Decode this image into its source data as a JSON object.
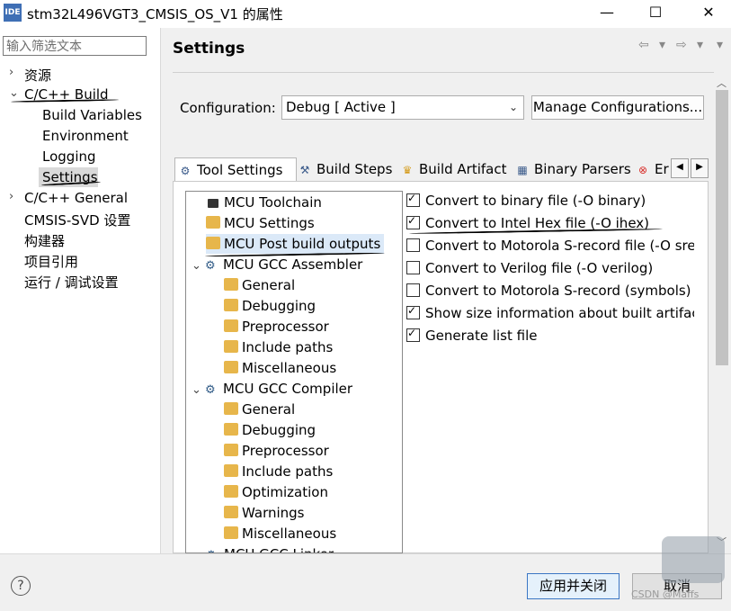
{
  "window": {
    "icon_text": "IDE",
    "title": "stm32L496VGT3_CMSIS_OS_V1 的属性",
    "minimize": "—",
    "maximize": "☐",
    "close": "✕"
  },
  "left": {
    "filter_placeholder": "输入筛选文本",
    "tree": [
      {
        "label": "资源",
        "expander": "›"
      },
      {
        "label": "C/C++ Build",
        "expander": "⌄"
      },
      {
        "label": "Build Variables"
      },
      {
        "label": "Environment"
      },
      {
        "label": "Logging"
      },
      {
        "label": "Settings"
      },
      {
        "label": "C/C++ General",
        "expander": "›"
      },
      {
        "label": "CMSIS-SVD 设置"
      },
      {
        "label": "构建器"
      },
      {
        "label": "项目引用"
      },
      {
        "label": "运行 / 调试设置"
      }
    ]
  },
  "main": {
    "title": "Settings",
    "nav": {
      "back": "⇦",
      "back_menu": "▾",
      "forward": "⇨",
      "forward_menu": "▾",
      "menu": "▾"
    },
    "configuration_label": "Configuration:",
    "configuration_value": "Debug  [ Active ]",
    "manage_label": "Manage Configurations...",
    "tabs": [
      {
        "label": "Tool Settings",
        "icon": "gear-icon"
      },
      {
        "label": "Build Steps",
        "icon": "hammer-icon"
      },
      {
        "label": "Build Artifact",
        "icon": "trophy-icon"
      },
      {
        "label": "Binary Parsers",
        "icon": "binary-icon"
      },
      {
        "label": "Er",
        "icon": "error-icon"
      }
    ],
    "tab_scroll_left": "◀",
    "tab_scroll_right": "▶",
    "tool_tree": [
      {
        "label": "MCU Toolchain"
      },
      {
        "label": "MCU Settings"
      },
      {
        "label": "MCU Post build outputs"
      },
      {
        "label": "MCU GCC Assembler"
      },
      {
        "label": "General"
      },
      {
        "label": "Debugging"
      },
      {
        "label": "Preprocessor"
      },
      {
        "label": "Include paths"
      },
      {
        "label": "Miscellaneous"
      },
      {
        "label": "MCU GCC Compiler"
      },
      {
        "label": "General"
      },
      {
        "label": "Debugging"
      },
      {
        "label": "Preprocessor"
      },
      {
        "label": "Include paths"
      },
      {
        "label": "Optimization"
      },
      {
        "label": "Warnings"
      },
      {
        "label": "Miscellaneous"
      },
      {
        "label": "MCU GCC Linker"
      }
    ],
    "options": [
      {
        "label": "Convert to binary file (-O binary)",
        "checked": true
      },
      {
        "label": "Convert to Intel Hex file (-O ihex)",
        "checked": true
      },
      {
        "label": "Convert to Motorola S-record file (-O srec)",
        "checked": false
      },
      {
        "label": "Convert to Verilog file (-O verilog)",
        "checked": false
      },
      {
        "label": "Convert to Motorola S-record (symbols) file",
        "checked": false
      },
      {
        "label": "Show size information about built artifact",
        "checked": true
      },
      {
        "label": "Generate list file",
        "checked": true
      }
    ]
  },
  "footer": {
    "help": "?",
    "apply_close": "应用并关闭",
    "cancel": "取消",
    "watermark": "CSDN @Maffs"
  },
  "colors": {
    "selection": "#dbe9f8",
    "accent": "#3b76c4",
    "folder": "#e7b64b"
  }
}
